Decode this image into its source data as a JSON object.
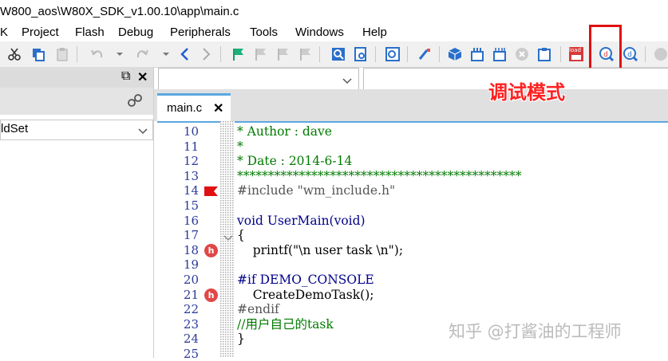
{
  "window": {
    "title": "W800_aos\\W80X_SDK_v1.00.10\\app\\main.c"
  },
  "menu": [
    "K",
    "Project",
    "Flash",
    "Debug",
    "Peripherals",
    "Tools",
    "Windows",
    "Help"
  ],
  "toolbar": {
    "icons": [
      "cut-icon",
      "copy-icon",
      "paste-icon",
      "undo-icon",
      "redo-icon",
      "nav-back-icon",
      "nav-forward-icon",
      "bookmark-icon",
      "bookmark-prev-icon",
      "bookmark-next-icon",
      "bookmark-clear-icon",
      "find-icon",
      "find-in-files-icon",
      "incremental-find-icon",
      "edit-wand-icon",
      "build-target-icon",
      "rebuild-icon",
      "batch-build-icon",
      "stop-build-icon",
      "translate-icon",
      "load-icon",
      "debug-session-icon",
      "debug-settings-icon"
    ],
    "load_label": "load"
  },
  "left_panel": {
    "target": "ldSet",
    "float_glyph": "⧉",
    "close_glyph": "✕"
  },
  "editor": {
    "tab_label": "main.c",
    "tab_close": "✕",
    "lines": [
      {
        "n": "10",
        "t": "* Author : dave",
        "cls": "c-green"
      },
      {
        "n": "11",
        "t": "*",
        "cls": "c-green"
      },
      {
        "n": "12",
        "t": "* Date : 2014-6-14",
        "cls": "c-green"
      },
      {
        "n": "13",
        "t": "**********************************************",
        "cls": "c-green"
      },
      {
        "n": "14",
        "t": "#include \"wm_include.h\"",
        "cls": "c-gray"
      },
      {
        "n": "15",
        "t": "",
        "cls": "c-black"
      },
      {
        "n": "16",
        "t": "void UserMain(void)",
        "cls": "c-blue"
      },
      {
        "n": "17",
        "t": "{",
        "cls": "c-black"
      },
      {
        "n": "18",
        "t": "    printf(\"\\n user task \\n\");",
        "cls": "c-black"
      },
      {
        "n": "19",
        "t": "",
        "cls": "c-black"
      },
      {
        "n": "20",
        "t": "#if DEMO_CONSOLE",
        "cls": "c-blue"
      },
      {
        "n": "21",
        "t": "    CreateDemoTask();",
        "cls": "c-black"
      },
      {
        "n": "22",
        "t": "#endif",
        "cls": "c-gray"
      },
      {
        "n": "23",
        "t": "//用户自己的task",
        "cls": "c-green"
      },
      {
        "n": "24",
        "t": "}",
        "cls": "c-black"
      },
      {
        "n": "25",
        "t": "",
        "cls": "c-black"
      }
    ],
    "breakpoint_glyph": "h"
  },
  "annotation": {
    "label": "调试模式",
    "color": "#e01010"
  },
  "watermark": "知乎 @打酱油的工程师",
  "colors": {
    "accent": "#5ba7e0",
    "annotation": "#ff2020"
  }
}
